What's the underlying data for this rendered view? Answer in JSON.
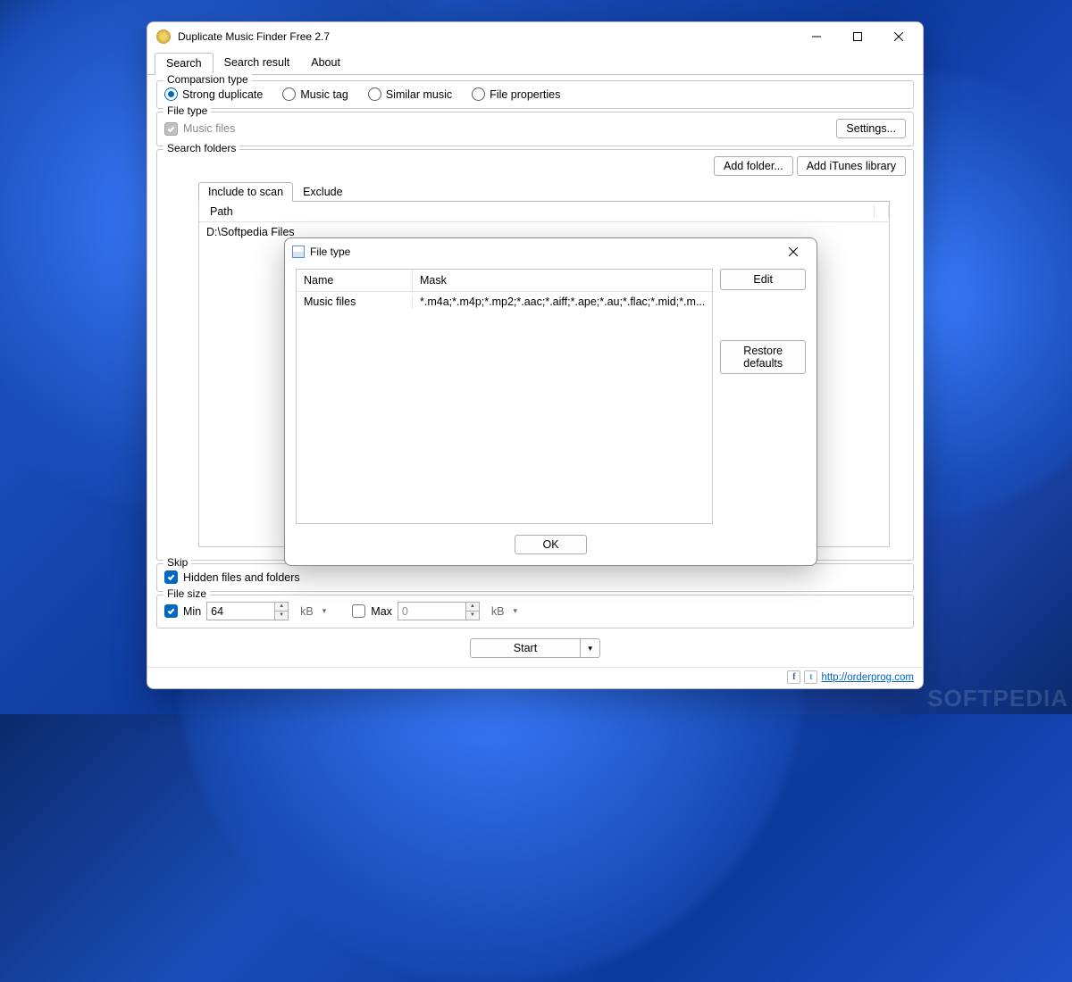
{
  "window": {
    "title": "Duplicate Music Finder Free 2.7",
    "tabs": [
      "Search",
      "Search result",
      "About"
    ],
    "activeTab": 0
  },
  "comparisonType": {
    "legend": "Comparsion type",
    "options": [
      "Strong duplicate",
      "Music tag",
      "Similar music",
      "File properties"
    ],
    "selected": 0
  },
  "fileType": {
    "legend": "File type",
    "checkboxLabel": "Music files",
    "settingsBtn": "Settings..."
  },
  "searchFolders": {
    "legend": "Search folders",
    "addFolderBtn": "Add folder...",
    "addItunesBtn": "Add iTunes library",
    "tabs": [
      "Include to scan",
      "Exclude"
    ],
    "pathHeader": "Path",
    "rows": [
      "D:\\Softpedia Files"
    ]
  },
  "skip": {
    "legend": "Skip",
    "hiddenLabel": "Hidden files and folders"
  },
  "fileSize": {
    "legend": "File size",
    "minLabel": "Min",
    "minValue": "64",
    "maxLabel": "Max",
    "maxValue": "0",
    "unit": "kB"
  },
  "startBtn": "Start",
  "footer": {
    "url": "http://orderprog.com"
  },
  "dialog": {
    "title": "File type",
    "cols": [
      "Name",
      "Mask"
    ],
    "row": {
      "name": "Music files",
      "mask": "*.m4a;*.m4p;*.mp2;*.aac;*.aiff;*.ape;*.au;*.flac;*.mid;*.m..."
    },
    "editBtn": "Edit",
    "restoreBtn": "Restore defaults",
    "okBtn": "OK"
  },
  "watermark": "SOFTPEDIA"
}
